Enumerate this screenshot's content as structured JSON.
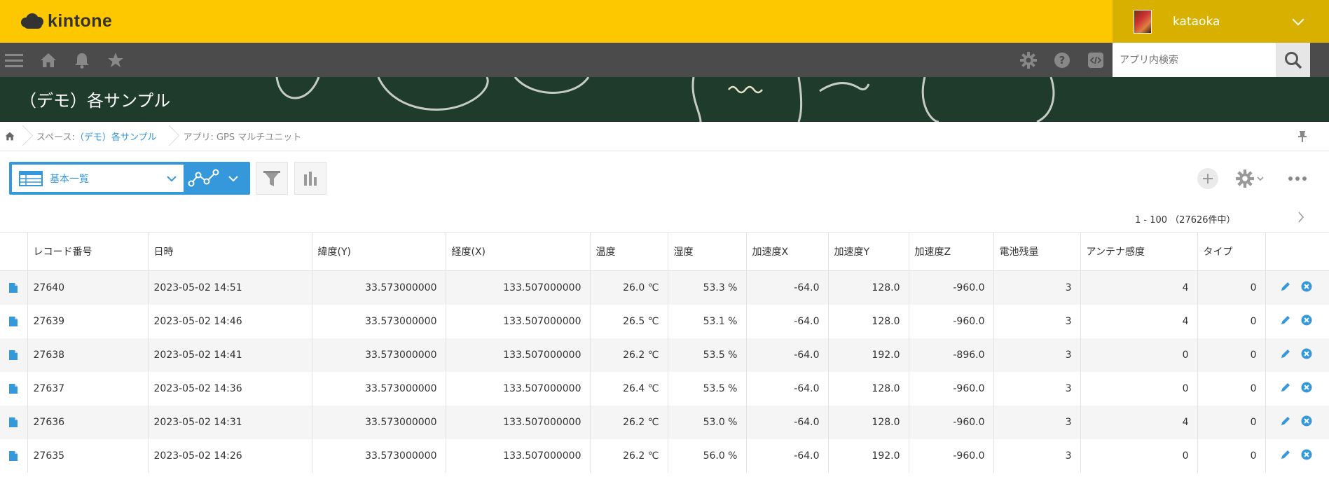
{
  "header": {
    "logo_text": "kintone",
    "username": "kataoka",
    "brand_color": "#fdc800"
  },
  "search": {
    "placeholder": "アプリ内検索"
  },
  "banner": {
    "title": "（デモ）各サンプル"
  },
  "breadcrumb": {
    "space_prefix": "スペース: ",
    "space_name": "（デモ）各サンプル",
    "app_label": "アプリ: GPS マルチユニット"
  },
  "view": {
    "name": "基本一覧"
  },
  "pager": {
    "text": "1 - 100 （27626件中）"
  },
  "table": {
    "columns": [
      "レコード番号",
      "日時",
      "緯度(Y)",
      "経度(X)",
      "温度",
      "湿度",
      "加速度X",
      "加速度Y",
      "加速度Z",
      "電池残量",
      "アンテナ感度",
      "タイプ"
    ],
    "rows": [
      [
        "27640",
        "2023-05-02 14:51",
        "33.573000000",
        "133.507000000",
        "26.0 ℃",
        "53.3 %",
        "-64.0",
        "128.0",
        "-960.0",
        "3",
        "4",
        "0"
      ],
      [
        "27639",
        "2023-05-02 14:46",
        "33.573000000",
        "133.507000000",
        "26.5 ℃",
        "53.1 %",
        "-64.0",
        "128.0",
        "-960.0",
        "3",
        "4",
        "0"
      ],
      [
        "27638",
        "2023-05-02 14:41",
        "33.573000000",
        "133.507000000",
        "26.2 ℃",
        "53.5 %",
        "-64.0",
        "192.0",
        "-896.0",
        "3",
        "0",
        "0"
      ],
      [
        "27637",
        "2023-05-02 14:36",
        "33.573000000",
        "133.507000000",
        "26.4 ℃",
        "53.5 %",
        "-64.0",
        "128.0",
        "-960.0",
        "3",
        "0",
        "0"
      ],
      [
        "27636",
        "2023-05-02 14:31",
        "33.573000000",
        "133.507000000",
        "26.2 ℃",
        "53.0 %",
        "-64.0",
        "128.0",
        "-960.0",
        "3",
        "4",
        "0"
      ],
      [
        "27635",
        "2023-05-02 14:26",
        "33.573000000",
        "133.507000000",
        "26.2 ℃",
        "56.0 %",
        "-64.0",
        "192.0",
        "-960.0",
        "3",
        "0",
        "0"
      ]
    ]
  }
}
